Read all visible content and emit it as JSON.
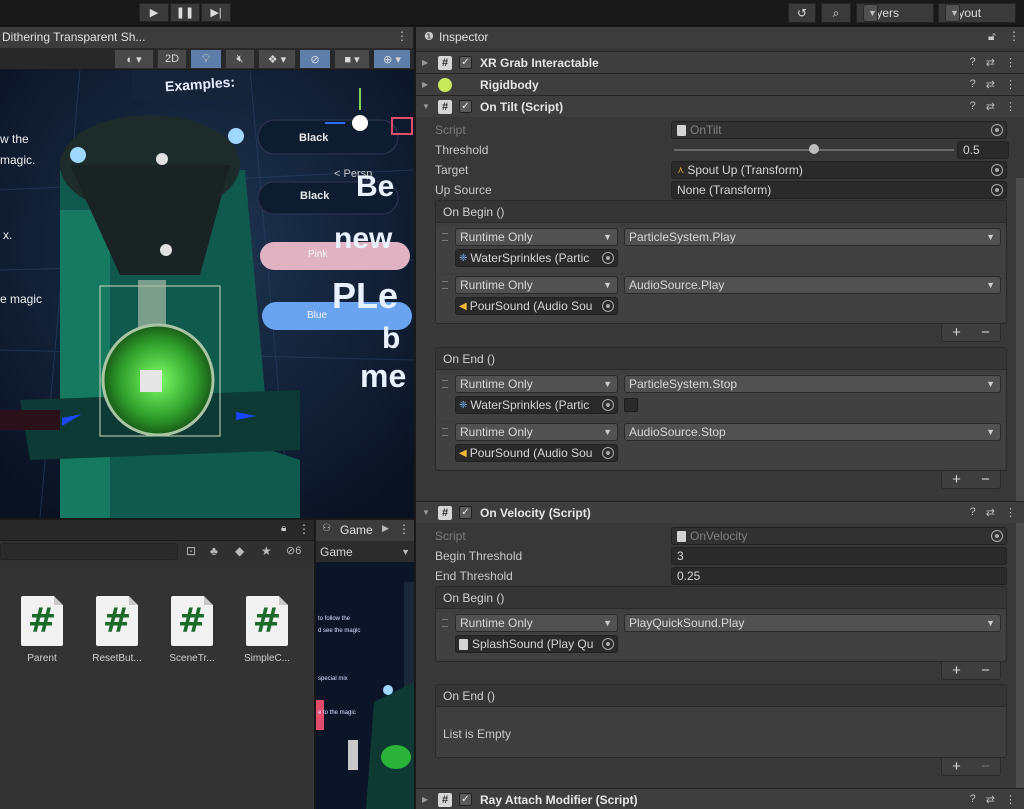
{
  "toolbar": {
    "play_icon": "play-icon",
    "pause_icon": "pause-icon",
    "step_icon": "step-icon",
    "history_icon": "history-icon",
    "search_icon": "search-icon",
    "layers_label": "Layers",
    "layout_label": "Layout"
  },
  "scene": {
    "tab_title": "Dithering Transparent Sh...",
    "mode_2d": "2D",
    "texts": {
      "examples": "Examples:",
      "the": "w the",
      "magic": "magic.",
      "x": "x.",
      "e_magic": "e magic",
      "black1": "Black",
      "black2": "Black",
      "pink": "Pink",
      "blue": "Blue",
      "persp": "< Persp",
      "be": "Be",
      "new": "new",
      "ple": "PLe",
      "b": "b",
      "me": "me"
    }
  },
  "project": {
    "search_placeholder": "",
    "hidden_count": "6",
    "assets": [
      {
        "name": "Parent"
      },
      {
        "name": "ResetBut..."
      },
      {
        "name": "SceneTr..."
      },
      {
        "name": "SimpleC..."
      }
    ]
  },
  "game": {
    "tab_title": "Game",
    "display_label": "Game",
    "texts": {
      "line1": "to follow the",
      "line2": "d see the magic",
      "line3": "special mix",
      "line4": "e to the magic"
    }
  },
  "inspector": {
    "tab_title": "Inspector",
    "components": [
      {
        "title": "XR Grab Interactable",
        "enabled": true,
        "collapsed": true
      },
      {
        "title": "Rigidbody",
        "collapsed": true
      },
      {
        "title": "On Tilt (Script)",
        "enabled": true,
        "collapsed": false
      },
      {
        "title": "On Velocity (Script)",
        "enabled": true,
        "collapsed": false
      },
      {
        "title": "Ray Attach Modifier (Script)",
        "enabled": true,
        "collapsed": true
      }
    ],
    "on_tilt": {
      "script_label": "Script",
      "script_value": "OnTilt",
      "threshold_label": "Threshold",
      "threshold_value": "0.5",
      "threshold_fraction": 0.5,
      "target_label": "Target",
      "target_value": "Spout Up (Transform)",
      "up_source_label": "Up Source",
      "up_source_value": "None (Transform)",
      "on_begin": {
        "title": "On Begin ()",
        "items": [
          {
            "mode": "Runtime Only",
            "function": "ParticleSystem.Play",
            "object": "WaterSprinkles (Partic"
          },
          {
            "mode": "Runtime Only",
            "function": "AudioSource.Play",
            "object": "PourSound (Audio Sou"
          }
        ]
      },
      "on_end": {
        "title": "On End ()",
        "items": [
          {
            "mode": "Runtime Only",
            "function": "ParticleSystem.Stop",
            "object": "WaterSprinkles (Partic"
          },
          {
            "mode": "Runtime Only",
            "function": "AudioSource.Stop",
            "object": "PourSound (Audio Sou"
          }
        ]
      }
    },
    "on_velocity": {
      "script_label": "Script",
      "script_value": "OnVelocity",
      "begin_label": "Begin Threshold",
      "begin_value": "3",
      "end_label": "End Threshold",
      "end_value": "0.25",
      "on_begin": {
        "title": "On Begin ()",
        "items": [
          {
            "mode": "Runtime Only",
            "function": "PlayQuickSound.Play",
            "object": "SplashSound (Play Qu"
          }
        ]
      },
      "on_end": {
        "title": "On End ()",
        "empty_text": "List is Empty"
      }
    },
    "plus_label": "+",
    "minus_label": "−"
  }
}
